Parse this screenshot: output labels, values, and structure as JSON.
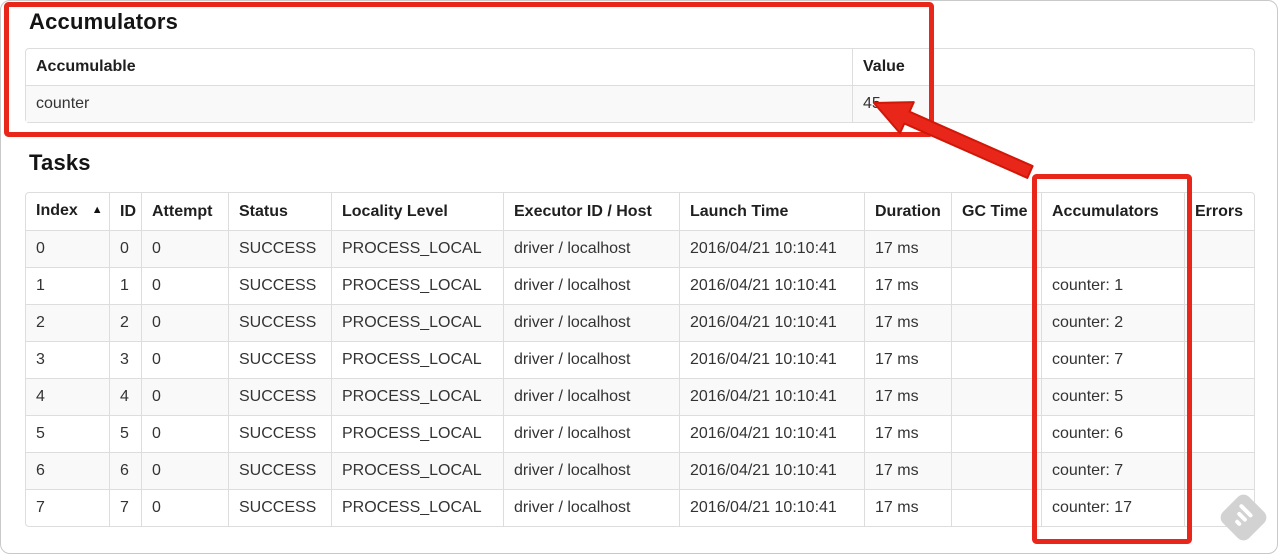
{
  "annotations": {
    "color": "#e8261a",
    "edge_color": "#d11708",
    "boxes": [
      "accumulators-section",
      "tasks-accumulators-column"
    ],
    "arrow_points_at": "45"
  },
  "accumulators_section": {
    "title": "Accumulators",
    "table": {
      "headers": [
        "Accumulable",
        "Value"
      ],
      "rows": [
        {
          "accumulable": "counter",
          "value": "45"
        }
      ]
    }
  },
  "tasks_section": {
    "title": "Tasks",
    "table": {
      "sort_indicator": "▲",
      "columns": [
        {
          "key": "index",
          "label": "Index",
          "sorted": true
        },
        {
          "key": "id",
          "label": "ID"
        },
        {
          "key": "attempt",
          "label": "Attempt"
        },
        {
          "key": "status",
          "label": "Status"
        },
        {
          "key": "locality_level",
          "label": "Locality Level"
        },
        {
          "key": "executor_id_host",
          "label": "Executor ID / Host"
        },
        {
          "key": "launch_time",
          "label": "Launch Time"
        },
        {
          "key": "duration",
          "label": "Duration"
        },
        {
          "key": "gc_time",
          "label": "GC Time"
        },
        {
          "key": "accumulators",
          "label": "Accumulators"
        },
        {
          "key": "errors",
          "label": "Errors"
        }
      ],
      "rows": [
        {
          "index": "0",
          "id": "0",
          "attempt": "0",
          "status": "SUCCESS",
          "locality_level": "PROCESS_LOCAL",
          "executor_id_host": "driver / localhost",
          "launch_time": "2016/04/21 10:10:41",
          "duration": "17 ms",
          "gc_time": "",
          "accumulators": "",
          "errors": ""
        },
        {
          "index": "1",
          "id": "1",
          "attempt": "0",
          "status": "SUCCESS",
          "locality_level": "PROCESS_LOCAL",
          "executor_id_host": "driver / localhost",
          "launch_time": "2016/04/21 10:10:41",
          "duration": "17 ms",
          "gc_time": "",
          "accumulators": "counter: 1",
          "errors": ""
        },
        {
          "index": "2",
          "id": "2",
          "attempt": "0",
          "status": "SUCCESS",
          "locality_level": "PROCESS_LOCAL",
          "executor_id_host": "driver / localhost",
          "launch_time": "2016/04/21 10:10:41",
          "duration": "17 ms",
          "gc_time": "",
          "accumulators": "counter: 2",
          "errors": ""
        },
        {
          "index": "3",
          "id": "3",
          "attempt": "0",
          "status": "SUCCESS",
          "locality_level": "PROCESS_LOCAL",
          "executor_id_host": "driver / localhost",
          "launch_time": "2016/04/21 10:10:41",
          "duration": "17 ms",
          "gc_time": "",
          "accumulators": "counter: 7",
          "errors": ""
        },
        {
          "index": "4",
          "id": "4",
          "attempt": "0",
          "status": "SUCCESS",
          "locality_level": "PROCESS_LOCAL",
          "executor_id_host": "driver / localhost",
          "launch_time": "2016/04/21 10:10:41",
          "duration": "17 ms",
          "gc_time": "",
          "accumulators": "counter: 5",
          "errors": ""
        },
        {
          "index": "5",
          "id": "5",
          "attempt": "0",
          "status": "SUCCESS",
          "locality_level": "PROCESS_LOCAL",
          "executor_id_host": "driver / localhost",
          "launch_time": "2016/04/21 10:10:41",
          "duration": "17 ms",
          "gc_time": "",
          "accumulators": "counter: 6",
          "errors": ""
        },
        {
          "index": "6",
          "id": "6",
          "attempt": "0",
          "status": "SUCCESS",
          "locality_level": "PROCESS_LOCAL",
          "executor_id_host": "driver / localhost",
          "launch_time": "2016/04/21 10:10:41",
          "duration": "17 ms",
          "gc_time": "",
          "accumulators": "counter: 7",
          "errors": ""
        },
        {
          "index": "7",
          "id": "7",
          "attempt": "0",
          "status": "SUCCESS",
          "locality_level": "PROCESS_LOCAL",
          "executor_id_host": "driver / localhost",
          "launch_time": "2016/04/21 10:10:41",
          "duration": "17 ms",
          "gc_time": "",
          "accumulators": "counter: 17",
          "errors": ""
        }
      ]
    }
  },
  "watermark_icon": "skitch-logo"
}
